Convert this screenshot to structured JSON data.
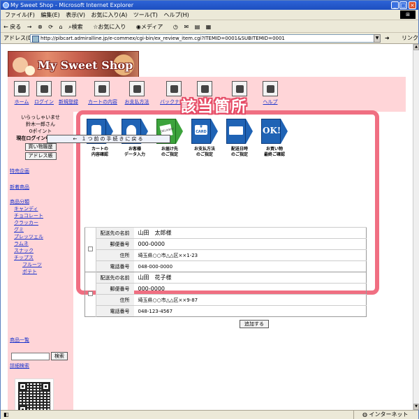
{
  "window": {
    "title": "My Sweet Shop - Microsoft Internet Explorer"
  },
  "menubar": {
    "items": [
      "ファイル(F)",
      "編集(E)",
      "表示(V)",
      "お気に入り(A)",
      "ツール(T)",
      "ヘルプ(H)"
    ]
  },
  "toolbar": {
    "back": "← 戻る",
    "forward": "→",
    "search": "検索",
    "favorites": "お気に入り",
    "media": "メディア"
  },
  "addressbar": {
    "label": "アドレス(D)",
    "url": "http://pibcart.admiralline.jp/e-commex/cgi-bin/ex_review_item.cgi?ITEMID=0001&SUBITEMID=0001",
    "go": "移動",
    "links": "リンク"
  },
  "statusbar": {
    "zone": "インターネット"
  },
  "banner": {
    "title": "My Sweet Shop"
  },
  "nav": {
    "items": [
      "ホーム",
      "ログイン",
      "新規登録",
      "カートの内容",
      "お支払方法",
      "バックナンバー",
      "ヘルプ"
    ]
  },
  "sidebar": {
    "greeting1": "いらっしゃいませ",
    "greeting2": "鈴木一郎さん",
    "points": "0ポイント",
    "login_status": "現在ログイン中です。",
    "history_button": "買い物履歴",
    "address_button": "アドレス帳",
    "special": "特売企画",
    "new_items": "新着商品",
    "category_heading": "商品分類",
    "categories": [
      "キャンディ",
      "チョコレート",
      "クラッカー",
      "グミ",
      "プレッツェル",
      "ラムネ",
      "スナック",
      "チップス"
    ],
    "subcategories": [
      "フルーツ",
      "ポテト"
    ],
    "product_list": "商品一覧",
    "search_button": "検索",
    "advanced_search": "詳細検索"
  },
  "callout": {
    "text": "該当箇所"
  },
  "steps": [
    {
      "line1": "カートの",
      "line2": "内容確認"
    },
    {
      "line1": "お客様",
      "line2": "データ入力"
    },
    {
      "line1": "お届け先",
      "line2": "のご指定"
    },
    {
      "line1": "お支払方法",
      "line2": "のご指定"
    },
    {
      "line1": "配送日時",
      "line2": "のご指定"
    },
    {
      "line1": "お買い物",
      "line2": "最終ご確認"
    }
  ],
  "step_icons": {
    "yen": "¥",
    "card": "CARD",
    "ok": "OK!",
    "delivery": "DELIVERY"
  },
  "back_button": "← １つ前の手続きに戻る",
  "addresses": {
    "labels": {
      "name": "配送先の名前",
      "zip": "郵便番号",
      "address": "住所",
      "phone": "電話番号"
    },
    "entries": [
      {
        "name": "山田　太郎様",
        "zip": "000-0000",
        "address": "埼玉県○○市△△区××1-23",
        "phone": "048-000-0000"
      },
      {
        "name": "山田　花子様",
        "zip": "000-0000",
        "address": "埼玉県○○市△△区××9-87",
        "phone": "048-123-4567"
      }
    ]
  },
  "add_button": "追加する"
}
